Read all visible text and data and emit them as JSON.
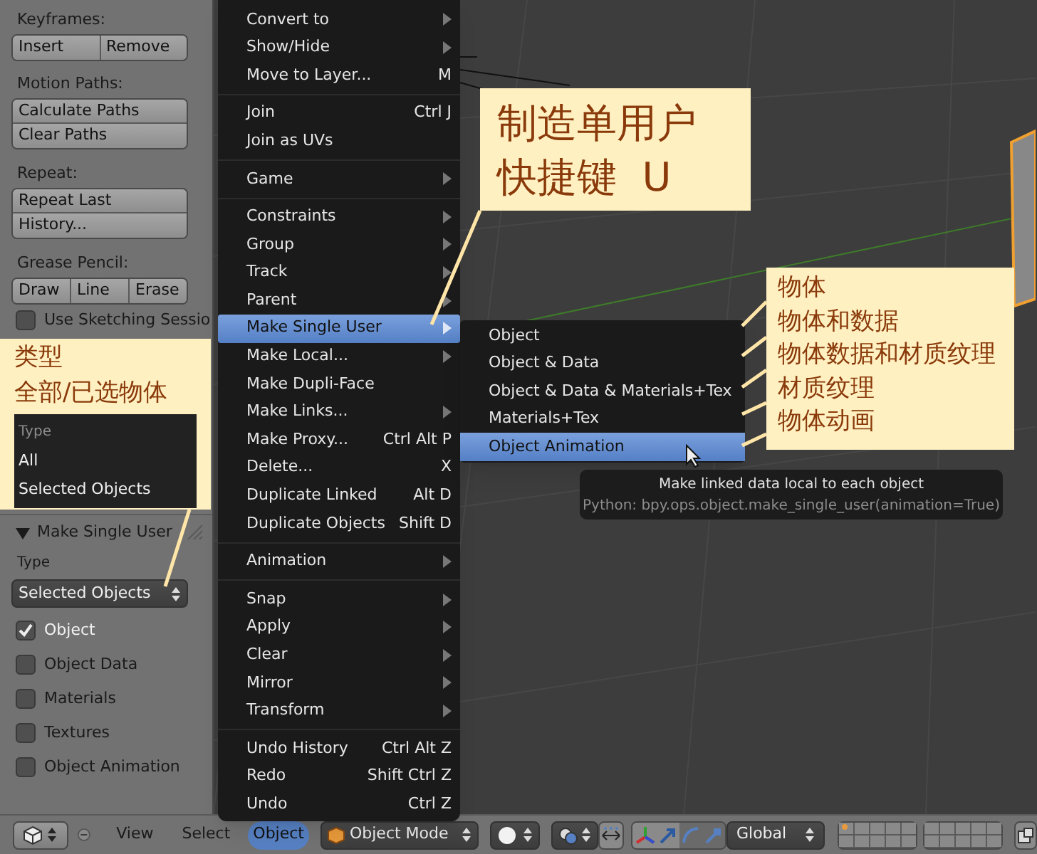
{
  "tool_panel": {
    "sections": [
      {
        "heading": "Keyframes:",
        "kind": "row",
        "buttons": [
          "Insert",
          "Remove"
        ]
      },
      {
        "heading": "Motion Paths:",
        "kind": "column",
        "buttons": [
          "Calculate Paths",
          "Clear Paths"
        ]
      },
      {
        "heading": "Repeat:",
        "kind": "column",
        "buttons": [
          "Repeat Last",
          "History..."
        ]
      },
      {
        "heading": "Grease Pencil:",
        "kind": "row",
        "buttons": [
          "Draw",
          "Line",
          "Erase"
        ]
      }
    ],
    "sketching_checkbox": {
      "label": "Use Sketching Sessio",
      "checked": false
    }
  },
  "operator_panel": {
    "title": "Make Single User",
    "expanded": true,
    "type_label": "Type",
    "type_value": "Selected Objects",
    "options": [
      {
        "label": "Object",
        "checked": true
      },
      {
        "label": "Object Data",
        "checked": false
      },
      {
        "label": "Materials",
        "checked": false
      },
      {
        "label": "Textures",
        "checked": false
      },
      {
        "label": "Object Animation",
        "checked": false
      }
    ]
  },
  "object_menu": {
    "sections": [
      [
        {
          "label": "Convert to",
          "submenu": true,
          "selected": false
        },
        {
          "label": "Show/Hide",
          "submenu": true,
          "selected": false
        },
        {
          "label": "Move to Layer...",
          "shortcut": "M",
          "submenu": false,
          "selected": false
        }
      ],
      [
        {
          "label": "Join",
          "shortcut": "Ctrl J",
          "submenu": false,
          "selected": false
        },
        {
          "label": "Join as UVs",
          "submenu": false,
          "selected": false
        }
      ],
      [
        {
          "label": "Game",
          "submenu": true,
          "selected": false
        }
      ],
      [
        {
          "label": "Constraints",
          "submenu": true,
          "selected": false
        },
        {
          "label": "Group",
          "submenu": true,
          "selected": false
        },
        {
          "label": "Track",
          "submenu": true,
          "selected": false
        },
        {
          "label": "Parent",
          "submenu": true,
          "selected": false
        },
        {
          "label": "Make Single User",
          "submenu": true,
          "selected": true
        },
        {
          "label": "Make Local...",
          "submenu": true,
          "selected": false
        },
        {
          "label": "Make Dupli-Face",
          "submenu": false,
          "selected": false
        },
        {
          "label": "Make Links...",
          "submenu": true,
          "selected": false
        },
        {
          "label": "Make Proxy...",
          "shortcut": "Ctrl Alt P",
          "submenu": false,
          "selected": false
        },
        {
          "label": "Delete...",
          "shortcut": "X",
          "submenu": false,
          "selected": false
        },
        {
          "label": "Duplicate Linked",
          "shortcut": "Alt D",
          "submenu": false,
          "selected": false
        },
        {
          "label": "Duplicate Objects",
          "shortcut": "Shift D",
          "submenu": false,
          "selected": false
        }
      ],
      [
        {
          "label": "Animation",
          "submenu": true,
          "selected": false
        }
      ],
      [
        {
          "label": "Snap",
          "submenu": true,
          "selected": false
        },
        {
          "label": "Apply",
          "submenu": true,
          "selected": false
        },
        {
          "label": "Clear",
          "submenu": true,
          "selected": false
        },
        {
          "label": "Mirror",
          "submenu": true,
          "selected": false
        },
        {
          "label": "Transform",
          "submenu": true,
          "selected": false
        }
      ],
      [
        {
          "label": "Undo History",
          "shortcut": "Ctrl Alt Z",
          "submenu": false,
          "selected": false
        },
        {
          "label": "Redo",
          "shortcut": "Shift Ctrl Z",
          "submenu": false,
          "selected": false
        },
        {
          "label": "Undo",
          "shortcut": "Ctrl Z",
          "submenu": false,
          "selected": false
        }
      ]
    ]
  },
  "submenu": {
    "items": [
      {
        "label": "Object",
        "selected": false
      },
      {
        "label": "Object & Data",
        "selected": false
      },
      {
        "label": "Object & Data & Materials+Tex",
        "selected": false
      },
      {
        "label": "Materials+Tex",
        "selected": false
      },
      {
        "label": "Object Animation",
        "selected": true
      }
    ]
  },
  "tooltip": {
    "description": "Make linked data local to each object",
    "python": "Python: bpy.ops.object.make_single_user(animation=True)"
  },
  "callouts": [
    {
      "kind": "title",
      "lines": [
        "制造单用户",
        "快捷键  U"
      ]
    },
    {
      "kind": "list",
      "lines": [
        "物体",
        "物体和数据",
        "物体数据和材质纹理",
        "材质纹理",
        "物体动画"
      ]
    },
    {
      "kind": "type",
      "lines": [
        "类型",
        "全部/已选物体"
      ],
      "options_heading": "Type",
      "options": [
        "All",
        "Selected Objects"
      ]
    }
  ],
  "header_bar": {
    "menus": [
      {
        "label": "View",
        "selected": false
      },
      {
        "label": "Select",
        "selected": false
      },
      {
        "label": "Object",
        "selected": true
      }
    ],
    "mode": "Object Mode",
    "orientation": "Global"
  }
}
